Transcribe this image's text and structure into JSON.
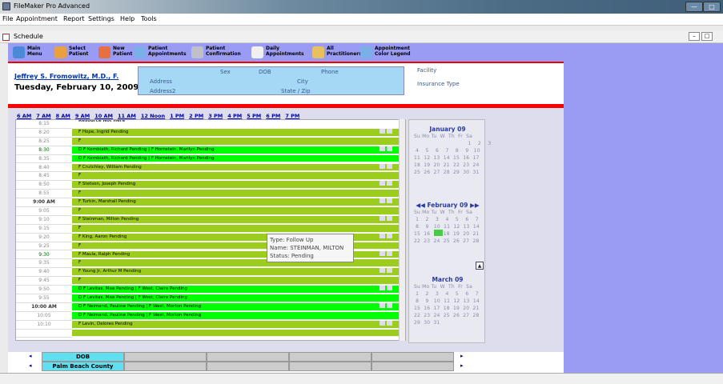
{
  "window": {
    "title": "FileMaker Pro Advanced",
    "minimize": "—",
    "maximize": "□"
  },
  "menu": {
    "items": [
      "File",
      "Appointment",
      "Report",
      "Settings",
      "Help",
      "Tools"
    ]
  },
  "schedule_window": {
    "title": "Schedule"
  },
  "toolbar": {
    "buttons": [
      {
        "l1": "Main",
        "l2": "Menu",
        "icon": "home-icon"
      },
      {
        "l1": "Select",
        "l2": "Patient",
        "icon": "person-icon"
      },
      {
        "l1": "New",
        "l2": "Patient",
        "icon": "new-person-icon"
      },
      {
        "l1": "Patient",
        "l2": "Appointments",
        "icon": "calendar-icon"
      },
      {
        "l1": "Patient",
        "l2": "Confirmation",
        "icon": "phone-icon"
      },
      {
        "l1": "Daily",
        "l2": "Appointments",
        "icon": "document-icon"
      },
      {
        "l1": "All",
        "l2": "Practitioners",
        "icon": "checklist-icon"
      },
      {
        "l1": "Appointment",
        "l2": "Color Legend",
        "icon": "legend-icon"
      }
    ]
  },
  "header": {
    "doctor": "Jeffrey S. Fromowitz, M.D., F.",
    "date": "Tuesday, February 10, 2009"
  },
  "patient_info": {
    "sex": "Sex",
    "dob": "DOB",
    "phone": "Phone",
    "address": "Address",
    "address2": "Address2",
    "city": "City",
    "state_zip": "State / Zip",
    "facility": "Facility",
    "insurance": "Insurance Type"
  },
  "hours": [
    "6 AM",
    "7 AM",
    "8 AM",
    "9 AM",
    "10 AM",
    "11 AM",
    "12 Noon",
    "1 PM",
    "2 PM",
    "3 PM",
    "4 PM",
    "5 PM",
    "6 PM",
    "7 PM"
  ],
  "resource_note": "Resource Not Here",
  "rows": [
    {
      "time": "8:15",
      "style": "",
      "tstyle": "",
      "text": ""
    },
    {
      "time": "8:20",
      "style": "green",
      "tstyle": "",
      "text": "F   Hope, Ingrid        Pending",
      "icons": true
    },
    {
      "time": "8:25",
      "style": "green",
      "tstyle": "",
      "text": "F"
    },
    {
      "time": "8:30",
      "style": "bright",
      "tstyle": "green",
      "text": "D  F   Kornblath, Richard        Pending   |   F   Hornstein, Marilyn  Pending",
      "icons": true
    },
    {
      "time": "8:35",
      "style": "bright",
      "tstyle": "",
      "text": "D  F   Kornblath, Richard        Pending   |   F   Hornstein, Marilyn  Pending"
    },
    {
      "time": "8:40",
      "style": "green",
      "tstyle": "",
      "text": "F   Crutchley, William  Pending",
      "icons": true
    },
    {
      "time": "8:45",
      "style": "green",
      "tstyle": "",
      "text": "F"
    },
    {
      "time": "8:50",
      "style": "green",
      "tstyle": "",
      "text": "F   Stetson, Joseph    Pending",
      "icons": true
    },
    {
      "time": "8:55",
      "style": "green",
      "tstyle": "",
      "text": "F"
    },
    {
      "time": "9:00 AM",
      "style": "green",
      "tstyle": "bold",
      "text": "F   Turkin, Marshall    Pending",
      "icons": true
    },
    {
      "time": "9:05",
      "style": "green",
      "tstyle": "",
      "text": "F"
    },
    {
      "time": "9:10",
      "style": "green",
      "tstyle": "",
      "text": "F   Steinman, Milton  Pending",
      "icons": true
    },
    {
      "time": "9:15",
      "style": "green",
      "tstyle": "",
      "text": "F"
    },
    {
      "time": "9:20",
      "style": "green",
      "tstyle": "",
      "text": "F   King, Aaron         Pending",
      "icons": true
    },
    {
      "time": "9:25",
      "style": "green",
      "tstyle": "",
      "text": "F"
    },
    {
      "time": "9:30",
      "style": "green",
      "tstyle": "green",
      "text": "F   Maula, Ralph        Pending",
      "icons": true
    },
    {
      "time": "9:35",
      "style": "green",
      "tstyle": "",
      "text": "F"
    },
    {
      "time": "9:40",
      "style": "green",
      "tstyle": "",
      "text": "F   Young Jr, Arthur M          Pending",
      "icons": true
    },
    {
      "time": "9:45",
      "style": "green",
      "tstyle": "",
      "text": "F"
    },
    {
      "time": "9:50",
      "style": "bright",
      "tstyle": "",
      "text": "D  F   Levitas, Mae   Pending   |   F   West, Claire         Pending",
      "icons": true
    },
    {
      "time": "9:55",
      "style": "bright",
      "tstyle": "",
      "text": "D  F   Levitas, Mae   Pending   |   F   West, Claire         Pending"
    },
    {
      "time": "10:00 AM",
      "style": "bright",
      "tstyle": "bold",
      "text": "D  F   Neimand, Pauline         Pending   |   F   West, Morton        Pending",
      "icons": true
    },
    {
      "time": "10:05",
      "style": "bright",
      "tstyle": "",
      "text": "D  F   Neimand, Pauline         Pending   |   F   West, Morton        Pending"
    },
    {
      "time": "10:10",
      "style": "green",
      "tstyle": "",
      "text": "F   Levin, Delores    Pending",
      "icons": true
    },
    {
      "time": "",
      "style": "green",
      "tstyle": "",
      "text": ""
    }
  ],
  "tooltip": {
    "type": "Type: Follow Up",
    "name": "Name: STEINMAN, MILTON",
    "status": "Status: Pending"
  },
  "calendars": [
    {
      "title": "January 09",
      "rows": [
        "Su Mo Tu  W  Th  Fr  Sa",
        "                                1    2    3",
        " 4    5    6    7    8    9   10",
        "11  12  13  14  15  16  17",
        "18  19  20  21  22  23  24",
        "25  26  27  28  29  30  31"
      ]
    },
    {
      "title": "February 09",
      "rows": [
        "Su Mo Tu  W  Th  Fr  Sa",
        " 1    2    3    4    5    6    7",
        " 8    9   10  11  12  13  14",
        "15  16  17  18  19  20  21",
        "22  23  24  25  26  27  28"
      ]
    },
    {
      "title": "March 09",
      "rows": [
        "Su Mo Tu  W  Th  Fr  Sa",
        " 1    2    3    4    5    6    7",
        " 8    9   10  11  12  13  14",
        "15  16  17  18  19  20  21",
        "22  23  24  25  26  27  28",
        "29  30  31"
      ]
    }
  ],
  "bottom": {
    "dob": "DOB",
    "county": "Palm Beach County"
  }
}
